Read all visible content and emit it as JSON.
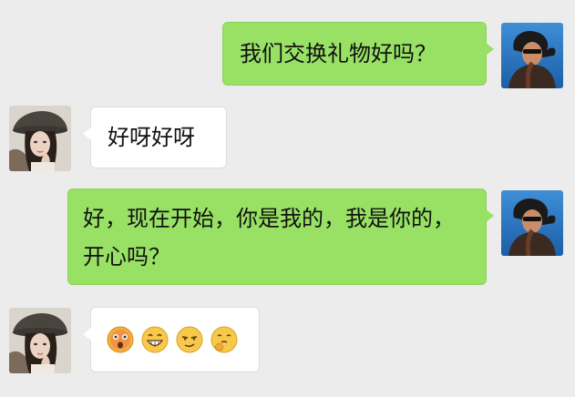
{
  "messages": [
    {
      "side": "right",
      "text": "我们交换礼物好吗？"
    },
    {
      "side": "left",
      "text": "好呀好呀"
    },
    {
      "side": "right",
      "text": "好，现在开始，你是我的，我是你的，开心吗？"
    },
    {
      "side": "left",
      "emojis": [
        "dizzy-face-emoji",
        "grin-emoji",
        "smirk-emoji",
        "thinking-emoji"
      ]
    }
  ],
  "colors": {
    "background": "#ececec",
    "mine_bubble": "#98e165",
    "theirs_bubble": "#ffffff"
  }
}
